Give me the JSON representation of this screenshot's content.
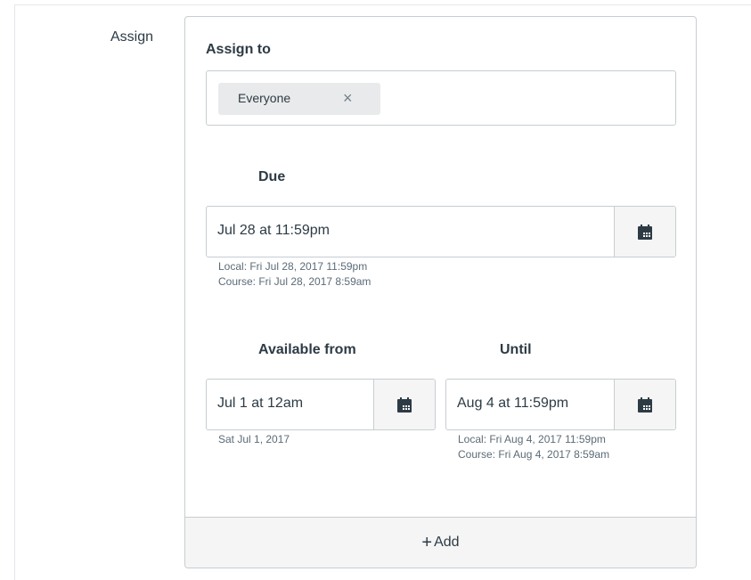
{
  "assign": {
    "label": "Assign",
    "assign_to_label": "Assign to",
    "token": {
      "label": "Everyone",
      "remove_glyph": "×"
    }
  },
  "due": {
    "label": "Due",
    "value": "Jul 28 at 11:59pm",
    "local_hint": "Local: Fri Jul 28, 2017 11:59pm",
    "course_hint": "Course: Fri Jul 28, 2017 8:59am"
  },
  "available_from": {
    "label": "Available from",
    "value": "Jul 1 at 12am",
    "hint": "Sat Jul 1, 2017"
  },
  "until": {
    "label": "Until",
    "value": "Aug 4 at 11:59pm",
    "local_hint": "Local: Fri Aug 4, 2017 11:59pm",
    "course_hint": "Course: Fri Aug 4, 2017 8:59am"
  },
  "add": {
    "plus": "+",
    "label": "Add"
  },
  "icons": {
    "calendar": "calendar-icon",
    "close": "close-icon",
    "plus": "plus-icon"
  }
}
